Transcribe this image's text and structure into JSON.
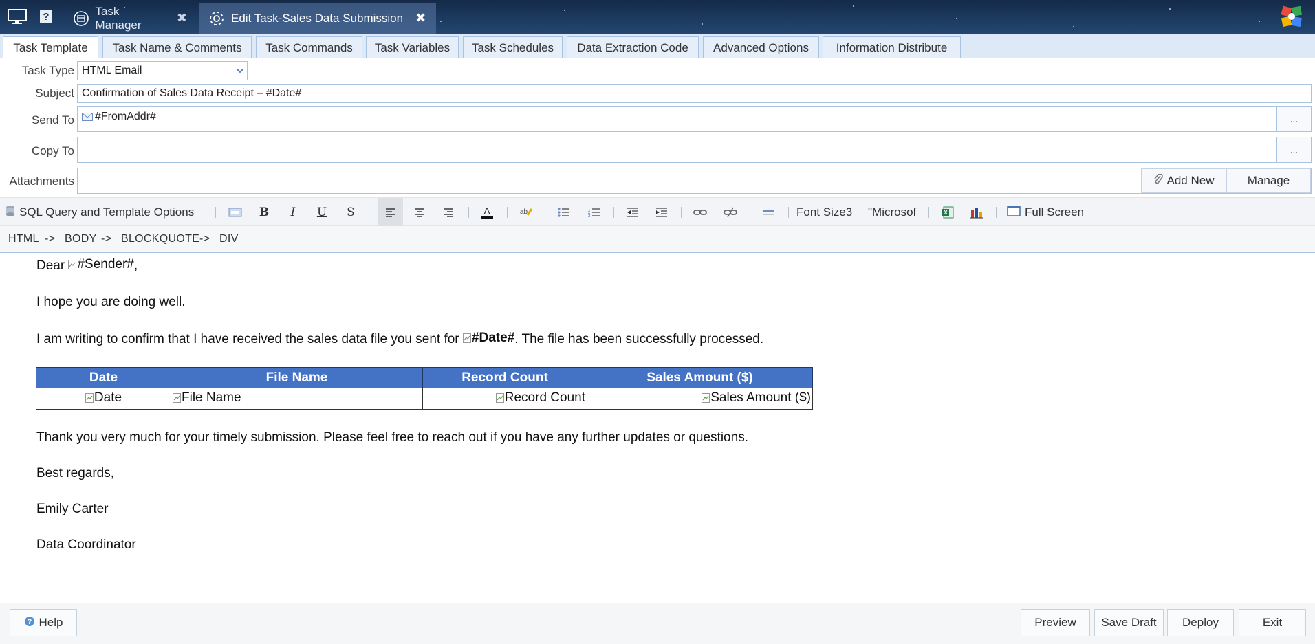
{
  "app": {
    "icons": [
      "monitor-icon",
      "help-icon"
    ],
    "tabs": [
      {
        "label": "Task Manager",
        "icon": "task-manager-icon"
      },
      {
        "label": "Edit Task-Sales Data Submission",
        "icon": "gear-icon"
      }
    ],
    "close_glyph": "✖"
  },
  "sub_tabs": [
    "Task Template",
    "Task Name & Comments",
    "Task Commands",
    "Task Variables",
    "Task Schedules",
    "Data Extraction Code",
    "Advanced Options",
    "Information Distribute"
  ],
  "form": {
    "task_type_label": "Task Type",
    "task_type_value": "HTML Email",
    "subject_label": "Subject",
    "subject_value": "Confirmation of Sales Data Receipt – #Date#",
    "send_to_label": "Send To",
    "send_to_value": "#FromAddr#",
    "copy_to_label": "Copy To",
    "copy_to_value": "",
    "attachments_label": "Attachments",
    "dots": "...",
    "add_new_label": "Add New",
    "manage_label": "Manage"
  },
  "toolbar": {
    "sql_label": "SQL Query and Template Options",
    "bold": "B",
    "italic": "I",
    "underline": "U",
    "strike": "S",
    "font_size_label": "Font Size3",
    "font_name_label": "\"Microsof",
    "full_screen_label": "Full Screen"
  },
  "path": [
    "HTML",
    "->",
    "BODY",
    "->",
    "BLOCKQUOTE",
    "->",
    "DIV"
  ],
  "email": {
    "greeting_prefix": "Dear ",
    "greeting_var": "#Sender#",
    "greeting_suffix": ",",
    "line1": "I hope you are doing well.",
    "line2_prefix": "I am writing to confirm that I have received the sales data file you sent for ",
    "line2_var": "#Date#",
    "line2_suffix": ". The file has been successfully processed.",
    "table_headers": [
      "Date",
      "File Name",
      "Record Count",
      "Sales Amount ($)"
    ],
    "table_row": [
      "Date",
      "File Name",
      "Record Count",
      "Sales Amount ($)"
    ],
    "line3": "Thank you very much for your timely submission. Please feel free to reach out if you have any further updates or questions.",
    "closing": "Best regards,",
    "name": "Emily Carter",
    "title": "Data Coordinator"
  },
  "footer": {
    "help_label": "Help",
    "preview_label": "Preview",
    "save_draft_label": "Save Draft",
    "deploy_label": "Deploy",
    "exit_label": "Exit"
  },
  "colors": {
    "header_bg": "#1c3a60",
    "tab_border": "#a9c4e2",
    "table_header": "#4472c4"
  }
}
